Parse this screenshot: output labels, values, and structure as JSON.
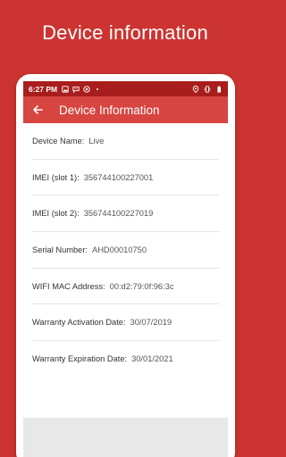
{
  "promo": {
    "title": "Device information"
  },
  "statusbar": {
    "time": "6:27 PM",
    "icons": [
      "image-icon",
      "message-icon",
      "chrome-icon",
      "dot-icon"
    ],
    "right_icons": [
      "location-icon",
      "vibrate-icon",
      "battery-icon"
    ]
  },
  "appbar": {
    "title": "Device Information",
    "back_icon": "arrow-left-icon"
  },
  "rows": [
    {
      "label": "Device Name:",
      "value": "Live"
    },
    {
      "label": "IMEI (slot 1):",
      "value": "356744100227001"
    },
    {
      "label": "IMEI (slot 2):",
      "value": "356744100227019"
    },
    {
      "label": "Serial Number:",
      "value": "AHD00010750"
    },
    {
      "label": "WIFI MAC Address:",
      "value": "00:d2:79:0f:96:3c"
    },
    {
      "label": "Warranty Activation Date:",
      "value": "30/07/2019"
    },
    {
      "label": "Warranty Expiration Date:",
      "value": "30/01/2021"
    }
  ],
  "colors": {
    "brand": "#cc3431",
    "appbar": "#d64540",
    "statusbar": "#a81e1c"
  }
}
